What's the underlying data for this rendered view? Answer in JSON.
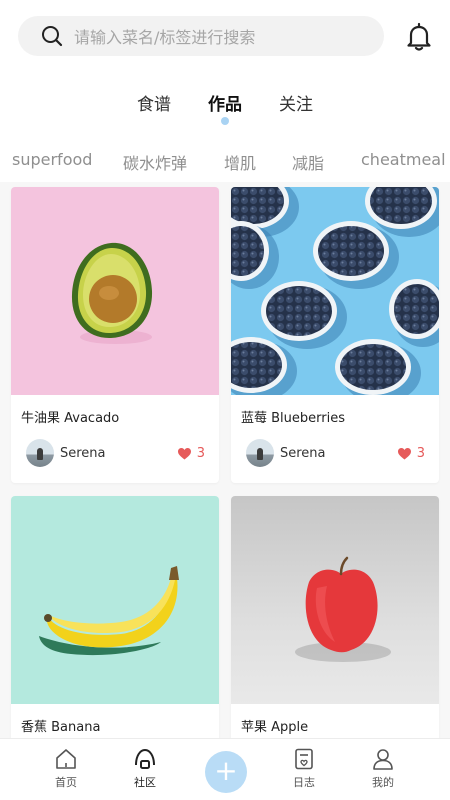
{
  "search": {
    "placeholder": "请输入菜名/标签进行搜索",
    "icon": "search-icon"
  },
  "header": {
    "bell_icon": "bell-icon"
  },
  "tabs": [
    {
      "label": "食谱",
      "active": false
    },
    {
      "label": "作品",
      "active": true
    },
    {
      "label": "关注",
      "active": false
    }
  ],
  "tags": [
    "superfood",
    "碳水炸弹",
    "增肌",
    "减脂",
    "cheatmeal"
  ],
  "cards": [
    {
      "title": "牛油果 Avacado",
      "author": "Serena",
      "likes": "3",
      "image": "avocado-image",
      "bg": "#f4c4de"
    },
    {
      "title": "蓝莓 Blueberries",
      "author": "Serena",
      "likes": "3",
      "image": "blueberries-image",
      "bg": "#7cc9ef"
    },
    {
      "title": "香蕉 Banana",
      "image": "banana-image",
      "bg": "#b4e9de"
    },
    {
      "title": "苹果 Apple",
      "image": "apple-image",
      "bg": "#d4d4d4"
    }
  ],
  "nav": [
    {
      "label": "首页",
      "icon": "home-icon"
    },
    {
      "label": "社区",
      "icon": "community-icon",
      "active": true
    },
    {
      "label": "+",
      "icon": "add-icon"
    },
    {
      "label": "日志",
      "icon": "journal-icon"
    },
    {
      "label": "我的",
      "icon": "profile-icon"
    }
  ],
  "colors": {
    "accent": "#b9dcf6",
    "like": "#e65a5a",
    "tab_indicator": "#a9d3f3"
  }
}
